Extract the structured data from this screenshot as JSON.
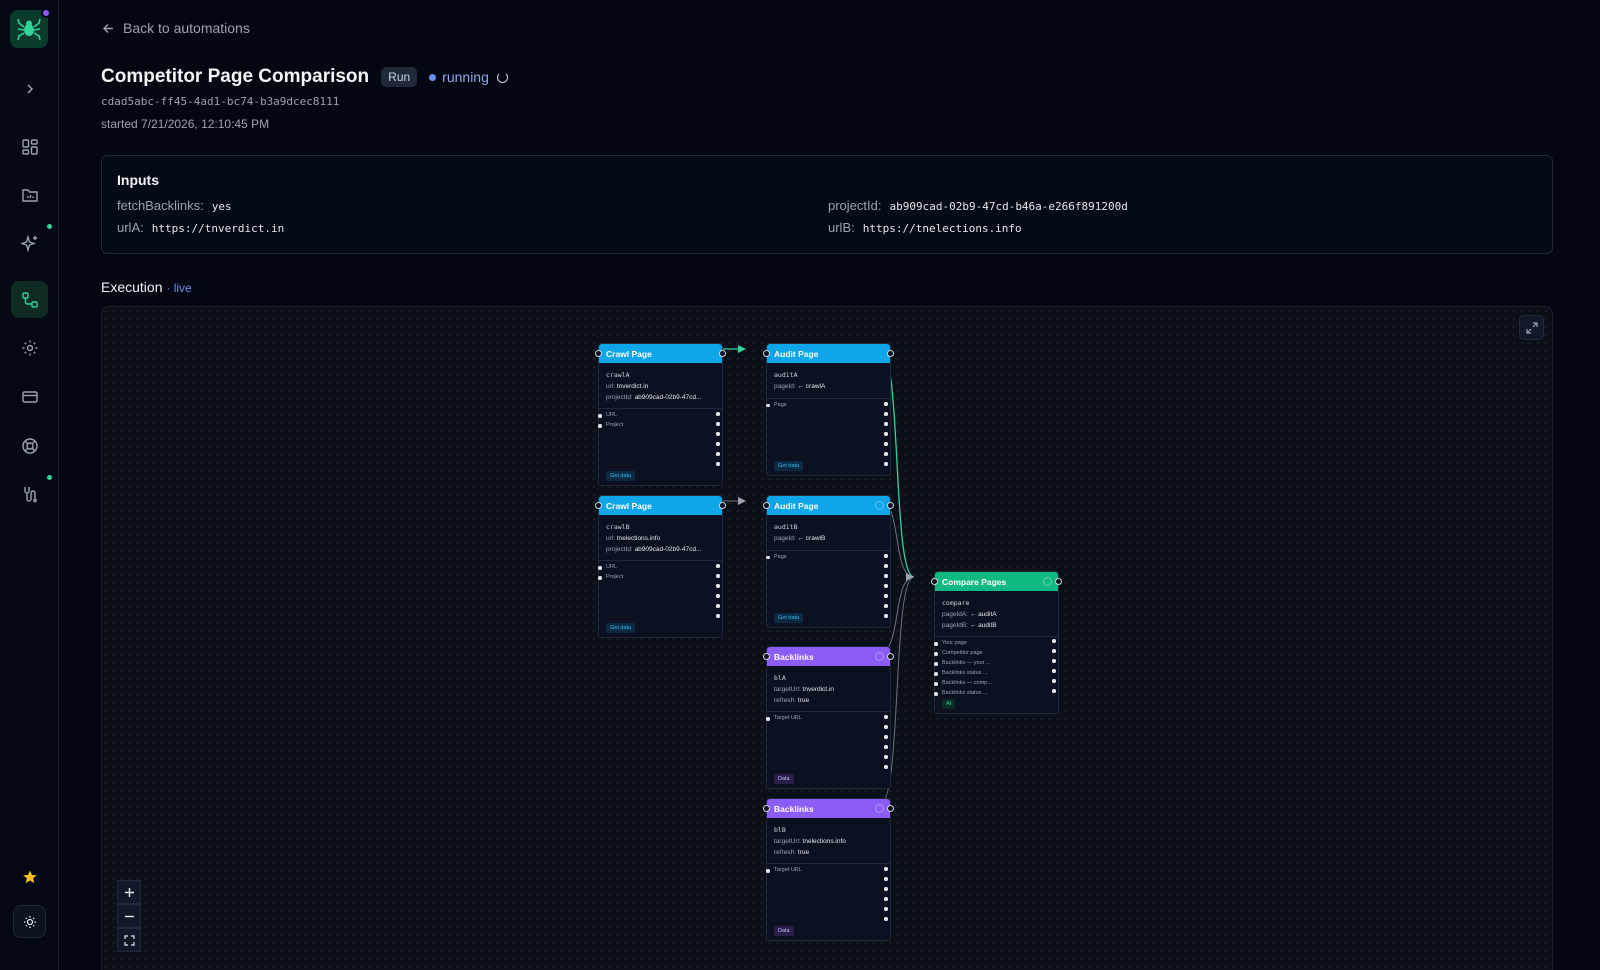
{
  "back_link": "Back to automations",
  "run": {
    "title": "Competitor Page Comparison",
    "badge": "Run",
    "status": "running",
    "id": "cdad5abc-ff45-4ad1-bc74-b3a9dcec8111",
    "started": "started 7/21/2026, 12:10:45 PM"
  },
  "inputs": {
    "title": "Inputs",
    "fetchBacklinks": {
      "key": "fetchBacklinks:",
      "value": "yes"
    },
    "urlA": {
      "key": "urlA:",
      "value": "https://tnverdict.in"
    },
    "projectId": {
      "key": "projectId:",
      "value": "ab909cad-02b9-47cd-b46a-e266f891200d"
    },
    "urlB": {
      "key": "urlB:",
      "value": "https://tnelections.info"
    }
  },
  "execution": {
    "title": "Execution",
    "live": "· live"
  },
  "nodes": {
    "crawlA": {
      "title": "Crawl Page",
      "id": "crawlA",
      "p1k": "url:",
      "p1v": "tnverdict.in",
      "p2k": "projectId:",
      "p2v": "ab909cad-02b9-47cd...",
      "port1": "URL",
      "port2": "Project",
      "tag": "Get data"
    },
    "crawlB": {
      "title": "Crawl Page",
      "id": "crawlB",
      "p1k": "url:",
      "p1v": "tnelections.info",
      "p2k": "projectId:",
      "p2v": "ab909cad-02b9-47cd...",
      "port1": "URL",
      "port2": "Project",
      "tag": "Get data"
    },
    "auditA": {
      "title": "Audit Page",
      "id": "auditA",
      "p1k": "pageId:",
      "p1v": "← crawlA",
      "port1": "Page",
      "tag": "Get data"
    },
    "auditB": {
      "title": "Audit Page",
      "id": "auditB",
      "p1k": "pageId:",
      "p1v": "← crawlB",
      "port1": "Page",
      "tag": "Get data"
    },
    "blA": {
      "title": "Backlinks",
      "id": "blA",
      "p1k": "targetUrl:",
      "p1v": "tnverdict.in",
      "p2k": "refresh:",
      "p2v": "true",
      "port1": "Target URL",
      "tag": "Data"
    },
    "blB": {
      "title": "Backlinks",
      "id": "blB",
      "p1k": "targetUrl:",
      "p1v": "tnelections.info",
      "p2k": "refresh:",
      "p2v": "true",
      "port1": "Target URL",
      "tag": "Data"
    },
    "compare": {
      "title": "Compare Pages",
      "id": "compare",
      "p1k": "pageIdA:",
      "p1v": "← auditA",
      "p2k": "pageIdB:",
      "p2v": "← auditB",
      "ports": [
        "Your page",
        "Competitor page",
        "Backlinks — your ...",
        "Backlinks status ...",
        "Backlinks — comp...",
        "Backlinks status ..."
      ],
      "tag": "AI"
    }
  },
  "colors": {
    "accent": "#34d399",
    "running": "#6b8ee8",
    "crawl": "#0ea5e9",
    "backlinks": "#8b5cf6",
    "compare": "#10b981"
  },
  "icons": [
    "spider-logo-icon",
    "chevron-right-icon",
    "dashboard-icon",
    "folder-icon",
    "sparkle-icon",
    "workflow-icon",
    "settings-icon",
    "billing-card-icon",
    "help-icon",
    "integrations-icon",
    "star-icon",
    "sun-icon"
  ]
}
